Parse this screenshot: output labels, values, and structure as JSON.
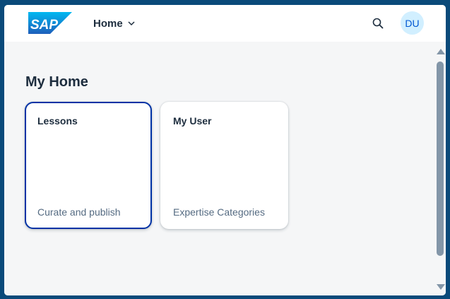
{
  "shellbar": {
    "logo_text": "SAP",
    "menu_label": "Home",
    "search_icon": "search-icon",
    "avatar_initials": "DU"
  },
  "page": {
    "title": "My Home"
  },
  "tiles": [
    {
      "title": "Lessons",
      "subtitle": "Curate and publish"
    },
    {
      "title": "My User",
      "subtitle": "Expertise Categories"
    }
  ],
  "colors": {
    "logo_blue": "#1a7fd0",
    "focus_border": "#0032a5",
    "avatar_bg": "#d1efff",
    "avatar_text": "#0057d2",
    "frame_bg": "#0a4a7a"
  }
}
